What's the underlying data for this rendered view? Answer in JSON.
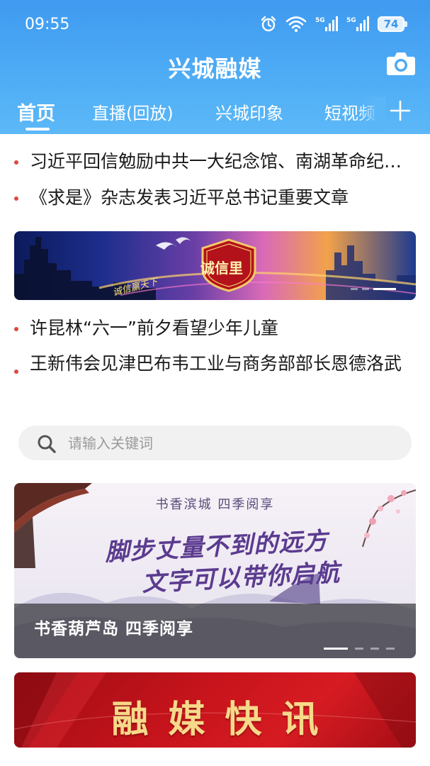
{
  "status_bar": {
    "time": "09:55",
    "battery": "74",
    "network_1": "5G",
    "network_2": "5G"
  },
  "header": {
    "title": "兴城融媒"
  },
  "tabs": [
    {
      "label": "首页",
      "active": true
    },
    {
      "label": "直播(回放)",
      "active": false
    },
    {
      "label": "兴城印象",
      "active": false
    },
    {
      "label": "短视频",
      "active": false
    }
  ],
  "headlines": [
    {
      "title": "习近平回信勉励中共一大纪念馆、南湖革命纪念馆党员干部群众"
    },
    {
      "title": "《求是》杂志发表习近平总书记重要文章"
    }
  ],
  "banner_1": {
    "seal_text": "诚信里",
    "slogan": "诚信赢天下"
  },
  "news": [
    {
      "title": "许昆林“六一”前夕看望少年儿童"
    },
    {
      "title": "王新伟会见津巴布韦工业与商务部部长恩德洛武"
    }
  ],
  "search": {
    "placeholder": "请输入关键词"
  },
  "banner_2": {
    "top_line": "书香滨城  四季阅享",
    "script_line_1": "脚步丈量不到的远方",
    "script_line_2": "文字可以带你启航",
    "caption": "书香葫芦岛 四季阅享"
  },
  "banner_3": {
    "title": "融媒快讯"
  },
  "colors": {
    "header_blue": "#4aa6f3",
    "bullet_red": "#e0473f",
    "banner_red": "#c8141c"
  }
}
